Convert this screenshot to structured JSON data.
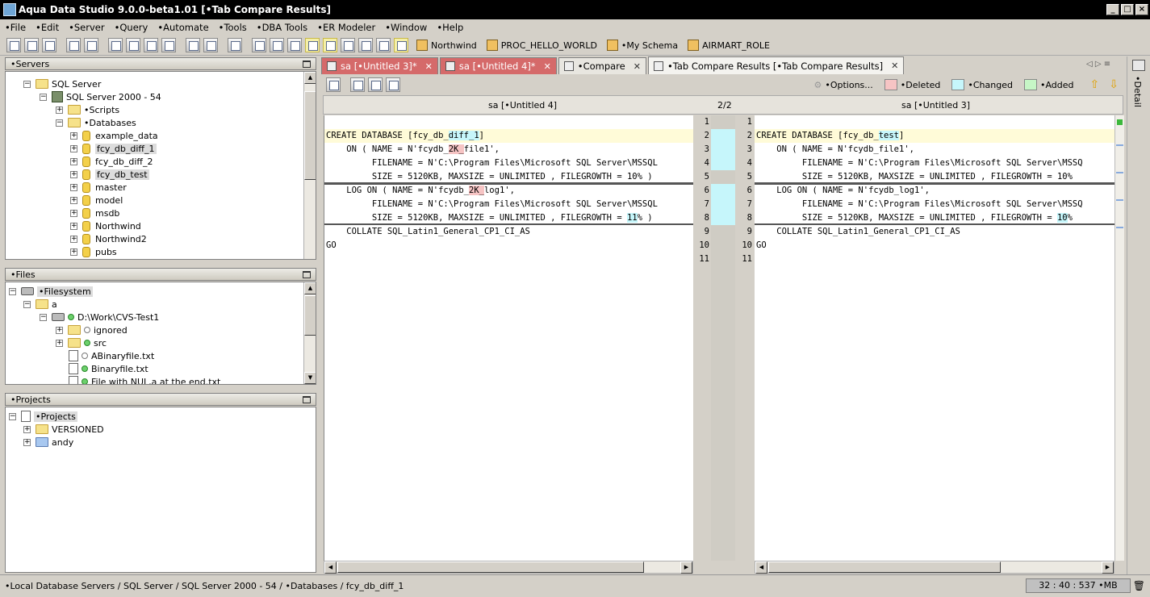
{
  "window": {
    "title": "Aqua Data Studio 9.0.0-beta1.01 [•Tab Compare Results]"
  },
  "menu": [
    "•File",
    "•Edit",
    "•Server",
    "•Query",
    "•Automate",
    "•Tools",
    "•DBA Tools",
    "•ER Modeler",
    "•Window",
    "•Help"
  ],
  "toolbar": {
    "schemas": [
      "Northwind",
      "PROC_HELLO_WORLD",
      "•My Schema",
      "AIRMART_ROLE"
    ]
  },
  "servers_panel": {
    "title": "•Servers",
    "sql_server": "SQL Server",
    "server_name": "SQL Server 2000 - 54",
    "scripts": "•Scripts",
    "databases": "•Databases",
    "db_items": [
      "example_data",
      "fcy_db_diff_1",
      "fcy_db_diff_2",
      "fcy_db_test",
      "master",
      "model",
      "msdb",
      "Northwind",
      "Northwind2",
      "pubs"
    ]
  },
  "files_panel": {
    "title": "•Files",
    "filesystem": "•Filesystem",
    "folder_a": "a",
    "drive": "D:\\Work\\CVS-Test1",
    "items": [
      "ignored",
      "src",
      "ABinaryfile.txt",
      "Binaryfile.txt",
      "File with NUL,a at the end.txt"
    ]
  },
  "projects_panel": {
    "title": "•Projects",
    "root": "•Projects",
    "items": [
      "VERSIONED",
      "andy"
    ]
  },
  "tabs": [
    {
      "label": "sa [•Untitled 3]*"
    },
    {
      "label": "sa [•Untitled 4]*"
    },
    {
      "label": "•Compare"
    },
    {
      "label": "•Tab Compare Results [•Tab Compare Results]"
    }
  ],
  "compare": {
    "options_label": "•Options...",
    "legend": {
      "deleted": "•Deleted",
      "changed": "•Changed",
      "added": "•Added"
    },
    "left_title": "sa [•Untitled 4]",
    "right_title": "sa [•Untitled 3]",
    "diff_counter": "2/2",
    "left_lines": [
      "",
      "CREATE DATABASE [fcy_db_diff_1]",
      "    ON ( NAME = N'fcydb_2K_file1',",
      "         FILENAME = N'C:\\Program Files\\Microsoft SQL Server\\MSSQL",
      "         SIZE = 5120KB, MAXSIZE = UNLIMITED , FILEGROWTH = 10% )",
      "    LOG ON ( NAME = N'fcydb_2K_log1',",
      "         FILENAME = N'C:\\Program Files\\Microsoft SQL Server\\MSSQL",
      "         SIZE = 5120KB, MAXSIZE = UNLIMITED , FILEGROWTH = 11% )",
      "    COLLATE SQL_Latin1_General_CP1_CI_AS",
      "GO",
      ""
    ],
    "right_lines": [
      "",
      "CREATE DATABASE [fcy_db_test]",
      "    ON ( NAME = N'fcydb_file1',",
      "         FILENAME = N'C:\\Program Files\\Microsoft SQL Server\\MSSQ",
      "         SIZE = 5120KB, MAXSIZE = UNLIMITED , FILEGROWTH = 10%",
      "    LOG ON ( NAME = N'fcydb_log1',",
      "         FILENAME = N'C:\\Program Files\\Microsoft SQL Server\\MSSQ",
      "         SIZE = 5120KB, MAXSIZE = UNLIMITED , FILEGROWTH = 10%",
      "    COLLATE SQL_Latin1_General_CP1_CI_AS",
      "GO",
      ""
    ],
    "line_numbers": [
      "1",
      "2",
      "3",
      "4",
      "5",
      "6",
      "7",
      "8",
      "9",
      "10",
      "11"
    ]
  },
  "right_strip": {
    "label": "•Detail"
  },
  "status": {
    "path": "•Local Database Servers / SQL Server / SQL Server 2000 - 54 / •Databases / fcy_db_diff_1",
    "memory": "32 : 40 : 537 •MB"
  },
  "colors": {
    "deleted": "#f6c4c4",
    "changed": "#c6f6fb",
    "added": "#c6f6c6",
    "current_line": "#fffbd8",
    "dirty_tab": "#d56a6a"
  }
}
